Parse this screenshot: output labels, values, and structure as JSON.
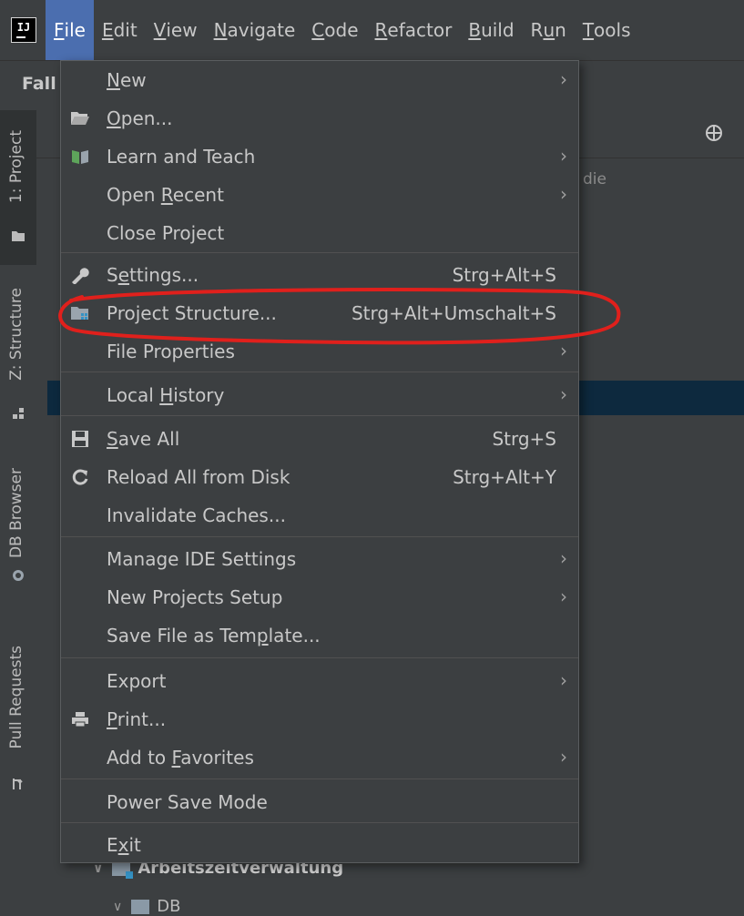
{
  "menubar": {
    "logo_text": "IJ",
    "items": [
      {
        "label": "File",
        "mnemonic_index": 0
      },
      {
        "label": "Edit",
        "mnemonic_index": 0
      },
      {
        "label": "View",
        "mnemonic_index": 0
      },
      {
        "label": "Navigate",
        "mnemonic_index": 0
      },
      {
        "label": "Code",
        "mnemonic_index": 0
      },
      {
        "label": "Refactor",
        "mnemonic_index": 0
      },
      {
        "label": "Build",
        "mnemonic_index": 0
      },
      {
        "label": "Run",
        "mnemonic_index": 1
      },
      {
        "label": "Tools",
        "mnemonic_index": 0
      }
    ]
  },
  "toolbar": {
    "crumb": "Fall"
  },
  "toolstrip": {
    "project": "1: Project",
    "structure": "Z: Structure",
    "db_browser": "DB Browser",
    "pull_requests": "Pull Requests"
  },
  "panel": {
    "hint": "die",
    "tree": [
      {
        "label": "Arbeitszeitverwaltung"
      },
      {
        "label": "DB"
      }
    ]
  },
  "file_menu": {
    "items": [
      {
        "label": "New",
        "mnemonic_index": 0,
        "shortcut": "",
        "submenu": true
      },
      {
        "label": "Open...",
        "mnemonic_index": 0,
        "shortcut": "",
        "submenu": false,
        "icon": "folder-open-icon"
      },
      {
        "label": "Learn and Teach",
        "mnemonic_index": -1,
        "shortcut": "",
        "submenu": true,
        "icon": "book-icon"
      },
      {
        "label": "Open Recent",
        "mnemonic_index": 5,
        "shortcut": "",
        "submenu": true
      },
      {
        "label": "Close Project",
        "mnemonic_index": -1,
        "shortcut": "",
        "submenu": false
      },
      {
        "label": "Settings...",
        "mnemonic_index": 1,
        "shortcut": "Strg+Alt+S",
        "submenu": false,
        "icon": "wrench-icon"
      },
      {
        "label": "Project Structure...",
        "mnemonic_index": -1,
        "shortcut": "Strg+Alt+Umschalt+S",
        "submenu": false,
        "icon": "project-structure-icon"
      },
      {
        "label": "File Properties",
        "mnemonic_index": -1,
        "shortcut": "",
        "submenu": true
      },
      {
        "label": "Local History",
        "mnemonic_index": 6,
        "shortcut": "",
        "submenu": true
      },
      {
        "label": "Save All",
        "mnemonic_index": 0,
        "shortcut": "Strg+S",
        "submenu": false,
        "icon": "save-icon"
      },
      {
        "label": "Reload All from Disk",
        "mnemonic_index": -1,
        "shortcut": "Strg+Alt+Y",
        "submenu": false,
        "icon": "reload-icon"
      },
      {
        "label": "Invalidate Caches...",
        "mnemonic_index": -1,
        "shortcut": "",
        "submenu": false
      },
      {
        "label": "Manage IDE Settings",
        "mnemonic_index": -1,
        "shortcut": "",
        "submenu": true
      },
      {
        "label": "New Projects Setup",
        "mnemonic_index": -1,
        "shortcut": "",
        "submenu": true
      },
      {
        "label": "Save File as Template...",
        "mnemonic_index": 16,
        "shortcut": "",
        "submenu": false
      },
      {
        "label": "Export",
        "mnemonic_index": -1,
        "shortcut": "",
        "submenu": true
      },
      {
        "label": "Print...",
        "mnemonic_index": 0,
        "shortcut": "",
        "submenu": false,
        "icon": "printer-icon"
      },
      {
        "label": "Add to Favorites",
        "mnemonic_index": 7,
        "shortcut": "",
        "submenu": true
      },
      {
        "label": "Power Save Mode",
        "mnemonic_index": -1,
        "shortcut": "",
        "submenu": false
      },
      {
        "label": "Exit",
        "mnemonic_index": 1,
        "shortcut": "",
        "submenu": false
      }
    ]
  },
  "colors": {
    "background": "#3c3f41",
    "menu_active": "#4b6eaf",
    "selection": "#0d293e",
    "annotation": "#e0201c"
  }
}
